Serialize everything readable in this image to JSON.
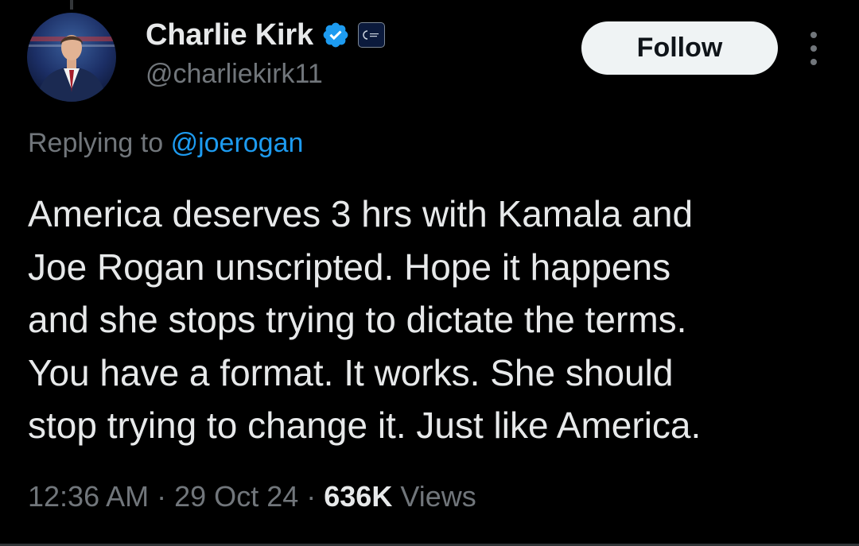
{
  "tweet": {
    "author": {
      "display_name": "Charlie Kirk",
      "handle": "@charliekirk11",
      "verified": true
    },
    "follow_label": "Follow",
    "reply": {
      "prefix": "Replying to",
      "mention": "@joerogan"
    },
    "text_lines": [
      "America deserves 3 hrs with Kamala and",
      "Joe Rogan unscripted. Hope it happens",
      "and she stops trying to dictate the terms.",
      "You have a format. It works. She should",
      "stop trying to change it. Just like America."
    ],
    "meta": {
      "time": "12:36 AM",
      "separator": "·",
      "date": "29 Oct 24",
      "views_count": "636K",
      "views_label": "Views"
    }
  },
  "colors": {
    "background": "#000000",
    "text_primary": "#e7e9ea",
    "text_secondary": "#71767b",
    "link": "#1d9bf0",
    "verified": "#1d9bf0",
    "follow_bg": "#eff3f4"
  },
  "icons": {
    "verified": "verified-badge-icon",
    "affiliate": "organization-badge-icon",
    "more": "more-options-icon"
  }
}
